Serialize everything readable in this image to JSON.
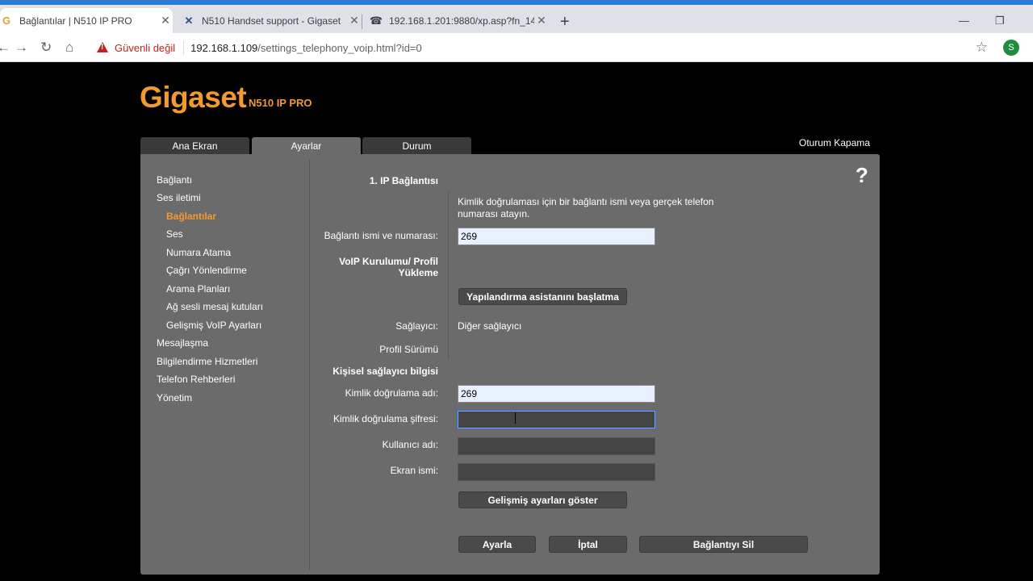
{
  "browser": {
    "tabs": [
      {
        "title": "Bağlantılar | N510 IP PRO",
        "icon": "gigaset-icon"
      },
      {
        "title": "N510 Handset support - Gigaset",
        "icon": "x-icon"
      },
      {
        "title": "192.168.1.201:9880/xp.asp?fn_14",
        "icon": "phone-icon"
      }
    ],
    "security_label": "Güvenli değil",
    "url_host": "192.168.1.109",
    "url_path": "/settings_telephony_voip.html?id=0",
    "profile_initial": "S"
  },
  "header": {
    "logo": "Gigaset",
    "model": "N510 IP PRO",
    "tabs": [
      "Ana Ekran",
      "Ayarlar",
      "Durum"
    ],
    "logout": "Oturum Kapama",
    "help": "?"
  },
  "sidebar": {
    "items": [
      "Bağlantı",
      "Ses iletimi",
      "Bağlantılar",
      "Ses",
      "Numara Atama",
      "Çağrı Yönlendirme",
      "Arama Planları",
      "Ağ sesli mesaj kutuları",
      "Gelişmiş VoIP Ayarları",
      "Mesajlaşma",
      "Bilgilendirme Hizmetleri",
      "Telefon Rehberleri",
      "Yönetim"
    ]
  },
  "form": {
    "section_title": "1. IP Bağlantısı",
    "hint_line1": "Kimlik doğrulaması için bir bağlantı ismi veya gerçek telefon",
    "hint_line2": "numarası atayın.",
    "connection_label": "Bağlantı ismi ve numarası:",
    "connection_value": "269",
    "voip_setup_line1": "VoIP Kurulumu/ Profil",
    "voip_setup_line2": "Yükleme",
    "wizard_button": "Yapılandırma asistanını başlatma",
    "provider_label": "Sağlayıcı:",
    "provider_value": "Diğer sağlayıcı",
    "profile_version_label": "Profil Sürümü",
    "personal_title": "Kişisel sağlayıcı bilgisi",
    "auth_name_label": "Kimlik doğrulama adı:",
    "auth_name_value": "269",
    "auth_password_label": "Kimlik doğrulama şifresi:",
    "auth_password_value": "",
    "username_label": "Kullanıcı adı:",
    "username_value": "",
    "display_name_label": "Ekran ismi:",
    "display_name_value": "",
    "advanced_button": "Gelişmiş ayarları göster",
    "set_button": "Ayarla",
    "cancel_button": "İptal",
    "delete_button": "Bağlantıyı Sil"
  }
}
